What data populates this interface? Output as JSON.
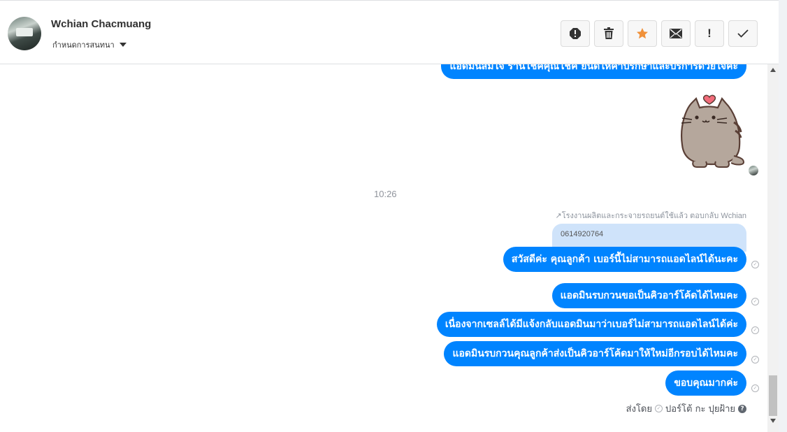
{
  "header": {
    "contact_name": "Wchian Chacmuang",
    "label_dropdown": "กำหนดการสนทนา",
    "actions": [
      {
        "name": "report-icon",
        "label": ""
      },
      {
        "name": "trash-icon",
        "label": ""
      },
      {
        "name": "star-icon",
        "label": ""
      },
      {
        "name": "envelope-icon",
        "label": ""
      },
      {
        "name": "exclamation-icon",
        "label": "!"
      },
      {
        "name": "checkmark-icon",
        "label": ""
      }
    ]
  },
  "conversation": {
    "cut_message": "แอดมินสมใจ ร้านโชคคุณโชค ยินดีให้คำปรึกษาและบริการด้วยใจค่ะ",
    "sticker": "pusheen-cat-heart",
    "timestamp": "10:26",
    "reply_note": "↗โรงงานผลิตและกระจายรถยนต์ใช้แล้ว ตอบกลับ Wchian",
    "quoted_text": "0614920764",
    "messages": [
      "สวัสดีค่ะ คุณลูกค้า เบอร์นี้ไม่สามารถแอดไลน์ได้นะคะ",
      "แอดมินรบกวนขอเป็นคิวอาร์โค้ดได้ไหมคะ",
      "เนื่องจากเซลล์ได้มีแจ้งกลับแอดมินมาว่าเบอร์ไม่สามารถแอดไลน์ได้ค่ะ",
      "แอดมินรบกวนคุณลูกค้าส่งเป็นคิวอาร์โค้ดมาให้ใหม่อีกรอบได้ไหมคะ",
      "ขอบคุณมากค่ะ"
    ],
    "sent_by_prefix": "ส่งโดย",
    "sent_by_name": "ปอร์โต้ กะ ปุยฝ้าย",
    "help_icon": "?",
    "tick_glyph": "✓"
  },
  "colors": {
    "bubble_blue": "#0084ff",
    "quoted_bg": "#cfe3fa",
    "star_orange": "#f0913a"
  }
}
